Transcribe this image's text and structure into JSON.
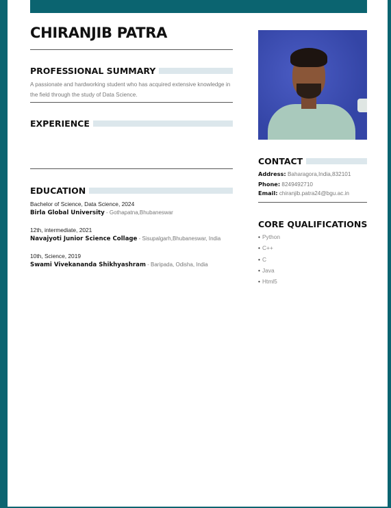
{
  "name": "CHIRANJIB PATRA",
  "summary": {
    "heading": "PROFESSIONAL SUMMARY",
    "text": "A passionate and hardworking student who has acquired extensive knowledge in the field through the study of Data Science."
  },
  "experience": {
    "heading": "EXPERIENCE"
  },
  "education": {
    "heading": "EDUCATION",
    "items": [
      {
        "degree": "Bachelor of Science, Data Science, 2024",
        "institution": "Birla Global University",
        "separator": " - ",
        "location": "Gothapatna,Bhubaneswar"
      },
      {
        "degree": "12th, intermediate, 2021",
        "institution": "Navajyoti Junior Science Collage",
        "separator": " - ",
        "location": "Sisupalgarh,Bhubaneswar, India"
      },
      {
        "degree": "10th, Science, 2019",
        "institution": "Swami Vivekananda Shikhyashram",
        "separator": " - ",
        "location": "Baripada, Odisha, India"
      }
    ]
  },
  "contact": {
    "heading": "CONTACT",
    "address_label": "Address:",
    "address": "Baharagora,India,832101",
    "phone_label": "Phone:",
    "phone": "8249492710",
    "email_label": "Email:",
    "email": "chiranjib.patra24@bgu.ac.in"
  },
  "qualifications": {
    "heading": "CORE QUALIFICATIONS",
    "bullet": "•",
    "items": [
      "Python",
      "C++",
      "C",
      "Java",
      "Html5"
    ]
  },
  "colors": {
    "accent": "#0b6470",
    "section_bar": "#dce7ec"
  }
}
